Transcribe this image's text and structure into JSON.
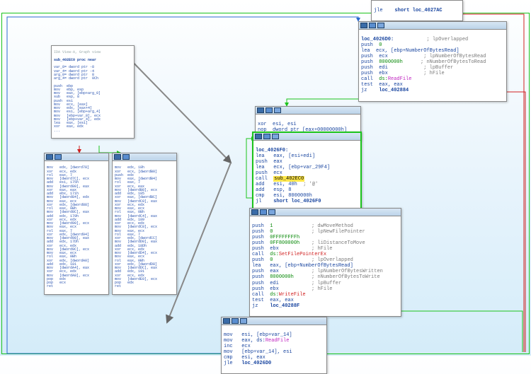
{
  "top_snippet": {
    "l1": "jle",
    "l1b": "short loc_4027AC"
  },
  "node_cond": {
    "label": "loc_4026D0:",
    "cmt1": "; lpOverlapped",
    "l1a": "push",
    "l1b": "0",
    "l2a": "lea",
    "l2b": "ecx, [ebp+NumberOfBytesRead]",
    "l3a": "push",
    "l3b": "ecx",
    "l3c": "; lpNumberOfBytesRead",
    "l4a": "push",
    "l4b": "8000000h",
    "l4c": "; nNumberOfBytesToRead",
    "l5a": "push",
    "l5b": "edi",
    "l5c": "; lpBuffer",
    "l6a": "push",
    "l6b": "ebx",
    "l6c": "; hFile",
    "l7a": "call",
    "l7b": "ds:",
    "l7c": "ReadFile",
    "l8a": "test",
    "l8b": "eax, eax",
    "l9a": "jz",
    "l9b": "loc_402884"
  },
  "node_xor": {
    "l1a": "xor",
    "l1b": "esi, esi",
    "l2a": "nop",
    "l2b": "dword ptr [eax+00000000h]"
  },
  "node_loop": {
    "label": "loc_4026F0:",
    "l1a": "lea",
    "l1b": "eax, [esi+edi]",
    "l2a": "push",
    "l2b": "eax",
    "l3a": "lea",
    "l3b": "ecx, [ebp+var_29F4]",
    "l4a": "push",
    "l4b": "ecx",
    "l5a": "call",
    "l5b": "sub_402EC0",
    "l6a": "add",
    "l6b": "esi, 40h",
    "l6c": "; '@'",
    "l7a": "add",
    "l7b": "esp, 8",
    "l8a": "cmp",
    "l8b": "esi, 8000000h",
    "l9a": "jl",
    "l9b": "short loc_4026F0"
  },
  "node_write": {
    "l1a": "push",
    "l1b": "1",
    "l1c": "; dwMoveMethod",
    "l2a": "push",
    "l2b": "0",
    "l2c": "; lpNewFilePointer",
    "l3a": "push",
    "l3b": "0FFFFFFFFh",
    "l4a": "push",
    "l4b": "0FF800000h",
    "l4c": "; liDistanceToMove",
    "l5a": "push",
    "l5b": "ebx",
    "l5c": "; hFile",
    "l6a": "call",
    "l6b": "ds:",
    "l6c": "SetFilePointerEx",
    "l7a": "push",
    "l7b": "0",
    "l7c": "; lpOverlapped",
    "l8a": "lea",
    "l8b": "eax, [ebp+NumberOfBytesRead]",
    "l9a": "push",
    "l9b": "eax",
    "l9c": "; lpNumberOfBytesWritten",
    "l10a": "push",
    "l10b": "8000000h",
    "l10c": "; nNumberOfBytesToWrite",
    "l11a": "push",
    "l11b": "edi",
    "l11c": "; lpBuffer",
    "l12a": "push",
    "l12b": "ebx",
    "l12c": "; hFile",
    "l13a": "call",
    "l13b": "ds:",
    "l13c": "WriteFile",
    "l14a": "test",
    "l14b": "eax, eax",
    "l15a": "jz",
    "l15b": "loc_40288F"
  },
  "node_add": {
    "l1a": "mov",
    "l1b": "esi, [ebp+var_14]",
    "l2a": "mov",
    "l2b": "eax, ds:",
    "l2c": "ReadFile",
    "l3a": "inc",
    "l3b": "ecx",
    "l4a": "mov",
    "l4b": "[ebp+var_14], esi",
    "l5a": "cmp",
    "l5b": "esi, eax",
    "l6a": "jle",
    "l6b": "loc_4026D0"
  },
  "left_header": "IDA View-A, Graph view",
  "proc_header": "sub_402EC0 proc near",
  "left_decl": [
    "var_8= dword ptr -8",
    "var_4= dword ptr -4",
    "arg_0= dword ptr  8",
    "arg_4= dword ptr  0Ch"
  ],
  "left_body_a": [
    "push  ebp",
    "mov   ebp, esp",
    "mov   eax, [ebp+arg_0]",
    "sub   esp, 8",
    "push  esi",
    "mov   ecx, [eax]",
    "mov   edx, [eax+4]",
    "mov   esi, [ebp+arg_4]",
    "mov   [ebp+var_8], ecx",
    "mov   [ebp+var_4], edx",
    "lea   eax, [esi]",
    "xor   eax, edx",
    "..."
  ],
  "left_col_a": [
    "mov   edx, [dword78]",
    "xor   ecx, edx",
    "rol   eax, 7",
    "mov   [dword7C], ecx",
    "add   esi, 175h",
    "mov   [dword80], eax",
    "xor   eax, eax",
    "add   ebx, 171h",
    "mov   [dword84], edx",
    "mov   eax, ecx",
    "xor   edx, [dword88]",
    "rol   eax, 0Bh",
    "mov   [dword8C], eax",
    "add   edx, 179h",
    "xor   ecx, edx",
    "mov   [dword90], ecx",
    "mov   eax, ecx",
    "rol   eax, 7",
    "xor   edx, [dword94]",
    "mov   [dword98], eax",
    "add   edx, 17Dh",
    "xor   ecx, edx",
    "mov   [dword9C], ecx",
    "mov   eax, ecx",
    "rol   eax, 0Bh",
    "xor   edx, [dwordA0]",
    "add   edx, 181",
    "mov   [dwordA4], eax",
    "xor   ecx, edx",
    "mov   [dwordA8], ecx",
    "pop   edx",
    "pop   ecx",
    "ret"
  ],
  "left_col_b": [
    "mov   edx, 18h",
    "xor   ecx, [dwordB0]",
    "push  edx",
    "mov   eax, [dwordB4]",
    "rol   eax, 7",
    "xor   ecx, eax",
    "mov   [dwordB8], ecx",
    "add   edx, 185",
    "xor   eax, [dwordBC]",
    "mov   [dwordC0], eax",
    "xor   ecx, edx",
    "mov   eax, ecx",
    "rol   eax, 0Bh",
    "mov   [dwordC4], eax",
    "add   edx, 189",
    "xor   ecx, edx",
    "mov   [dwordC8], ecx",
    "mov   eax, ecx",
    "rol   eax, 7",
    "xor   edx, [dwordCC]",
    "mov   [dwordD0], eax",
    "add   edx, 18Dh",
    "xor   ecx, edx",
    "mov   [dwordD4], ecx",
    "mov   eax, ecx",
    "rol   eax, 0Bh",
    "xor   edx, [dwordD8]",
    "mov   [dwordDC], eax",
    "add   edx, 191",
    "xor   ecx, edx",
    "mov   [dwordE0], ecx",
    "pop   edx",
    "ret"
  ]
}
